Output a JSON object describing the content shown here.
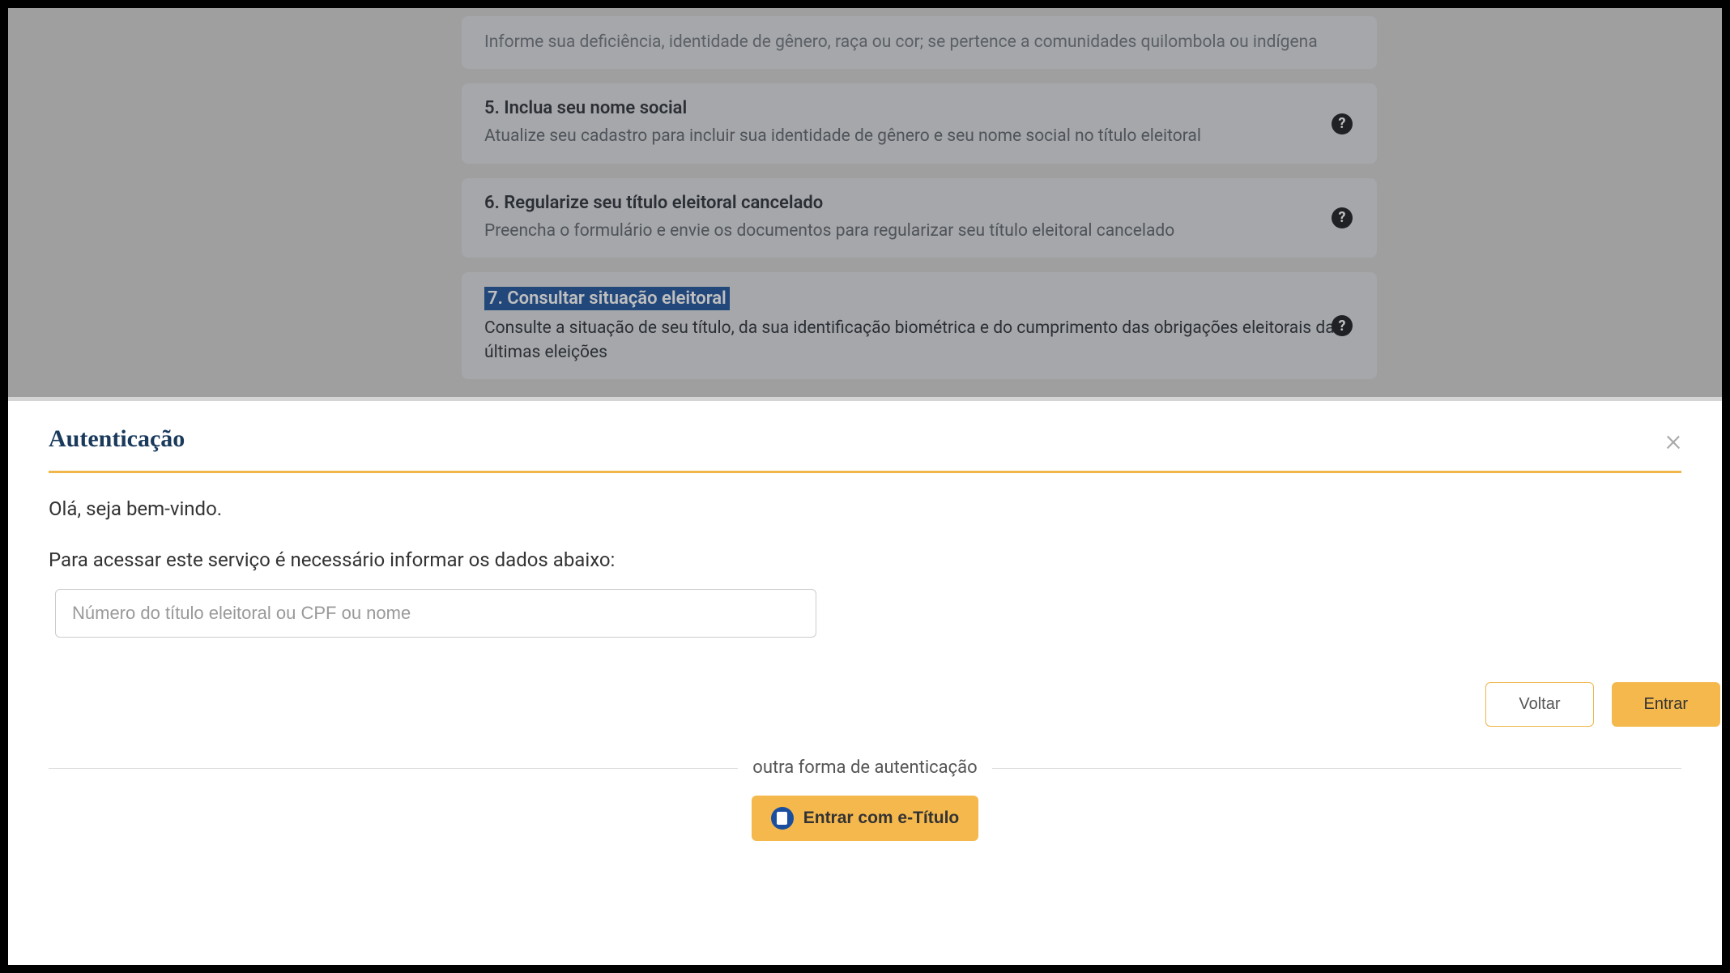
{
  "background": {
    "cards": [
      {
        "title": "",
        "desc": "Informe sua deficiência, identidade de gênero, raça ou cor; se pertence a comunidades quilombola ou indígena"
      },
      {
        "title": "5. Inclua seu nome social",
        "desc": "Atualize seu cadastro para incluir sua identidade de gênero e seu nome social no título eleitoral"
      },
      {
        "title": "6. Regularize seu título eleitoral cancelado",
        "desc": "Preencha o formulário e envie os documentos para regularizar seu título eleitoral cancelado"
      },
      {
        "title": "7. Consultar situação eleitoral",
        "desc": "Consulte a situação de seu título, da sua identificação biométrica e do cumprimento das obrigações eleitorais das últimas eleições"
      }
    ]
  },
  "modal": {
    "title": "Autenticação",
    "greeting": "Olá, seja bem-vindo.",
    "instruction": "Para acessar este serviço é necessário informar os dados abaixo:",
    "input_placeholder": "Número do título eleitoral ou CPF ou nome",
    "back_label": "Voltar",
    "enter_label": "Entrar",
    "alt_auth_label": "outra forma de autenticação",
    "etitulo_label": "Entrar com e-Título"
  }
}
